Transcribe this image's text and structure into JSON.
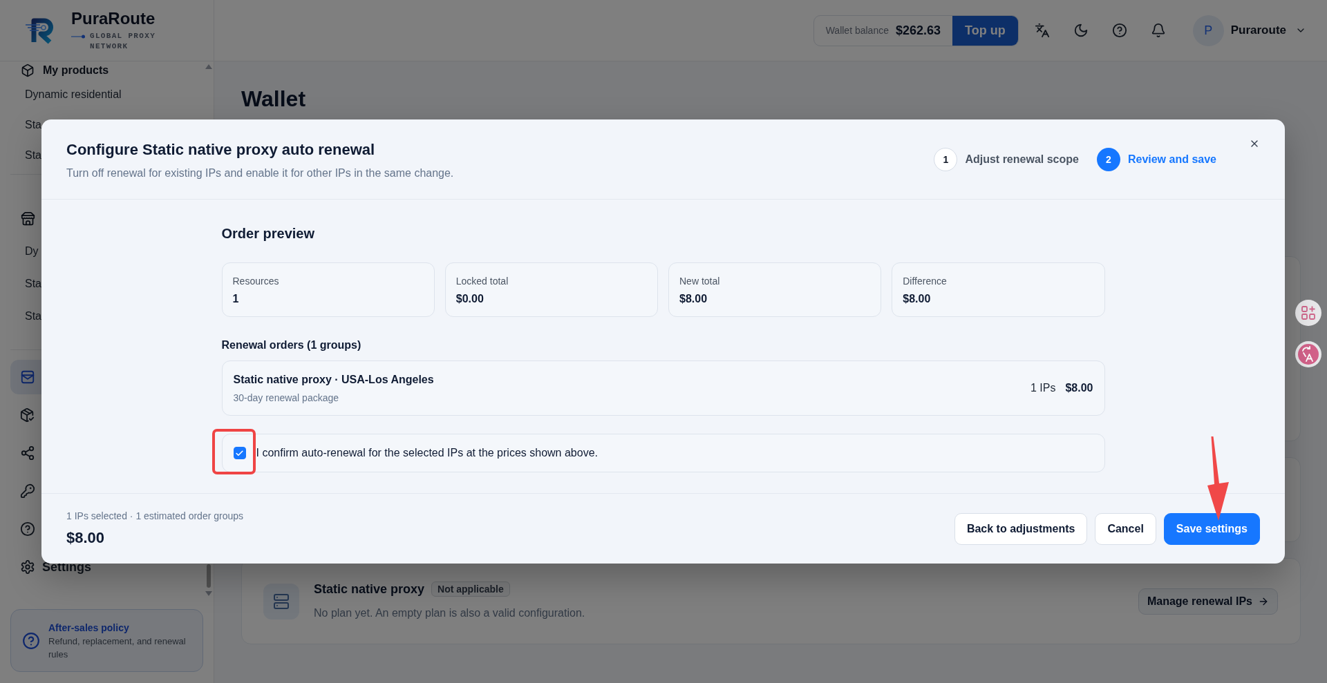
{
  "brand": {
    "name": "PuraRoute",
    "tagline": "GLOBAL PROXY NETWORK"
  },
  "header": {
    "wallet": {
      "label": "Wallet balance",
      "amount": "$262.63",
      "action": "Top up"
    },
    "user": {
      "initial": "P",
      "name": "Puraroute"
    }
  },
  "sidebar": {
    "groups": [
      {
        "label": "My products",
        "items": [
          {
            "label": "Dynamic residential",
            "selected": false
          },
          {
            "label": "Sta",
            "selected": false
          },
          {
            "label": "Sta",
            "selected": false
          }
        ]
      },
      {
        "items": [
          {
            "label": "Dy",
            "selected": false
          },
          {
            "label": "Sta",
            "selected": false
          },
          {
            "label": "Sta",
            "selected": false
          }
        ]
      }
    ],
    "nav": [
      {
        "selected": true
      },
      {
        "selected": false
      },
      {
        "selected": false
      },
      {
        "selected": false
      },
      {
        "selected": false
      },
      {
        "label": "Settings",
        "selected": false
      }
    ],
    "policy": {
      "title": "After-sales policy",
      "text": "Refund, replacement, and renewal rules"
    }
  },
  "main": {
    "title": "Wallet",
    "plans": [
      {
        "name": "Static native proxy",
        "badge": "Not applicable",
        "description": "No plan yet. An empty plan is also a valid configuration.",
        "action": "Manage renewal IPs"
      }
    ]
  },
  "modal": {
    "title": "Configure Static native proxy auto renewal",
    "subtitle": "Turn off renewal for existing IPs and enable it for other IPs in the same change.",
    "steps": [
      {
        "number": "1",
        "label": "Adjust renewal scope",
        "selected": false
      },
      {
        "number": "2",
        "label": "Review and save",
        "selected": true
      }
    ],
    "preview_title": "Order preview",
    "stats": [
      {
        "label": "Resources",
        "value": "1"
      },
      {
        "label": "Locked total",
        "value": "$0.00"
      },
      {
        "label": "New total",
        "value": "$8.00"
      },
      {
        "label": "Difference",
        "value": "$8.00"
      }
    ],
    "orders_title": "Renewal orders (1 groups)",
    "orders": [
      {
        "name": "Static native proxy · USA-Los Angeles",
        "package": "30-day renewal package",
        "ips": "1 IPs",
        "price": "$8.00"
      }
    ],
    "confirm": {
      "checked": true,
      "text": "I confirm auto-renewal for the selected IPs at the prices shown above.",
      "highlighted": true
    },
    "footer": {
      "summary": "1 IPs selected · 1 estimated order groups",
      "total": "$8.00",
      "buttons": [
        {
          "label": "Back to adjustments",
          "kind": "secondary",
          "pointed": false
        },
        {
          "label": "Cancel",
          "kind": "secondary",
          "pointed": false
        },
        {
          "label": "Save settings",
          "kind": "primary",
          "pointed": true
        }
      ]
    }
  }
}
